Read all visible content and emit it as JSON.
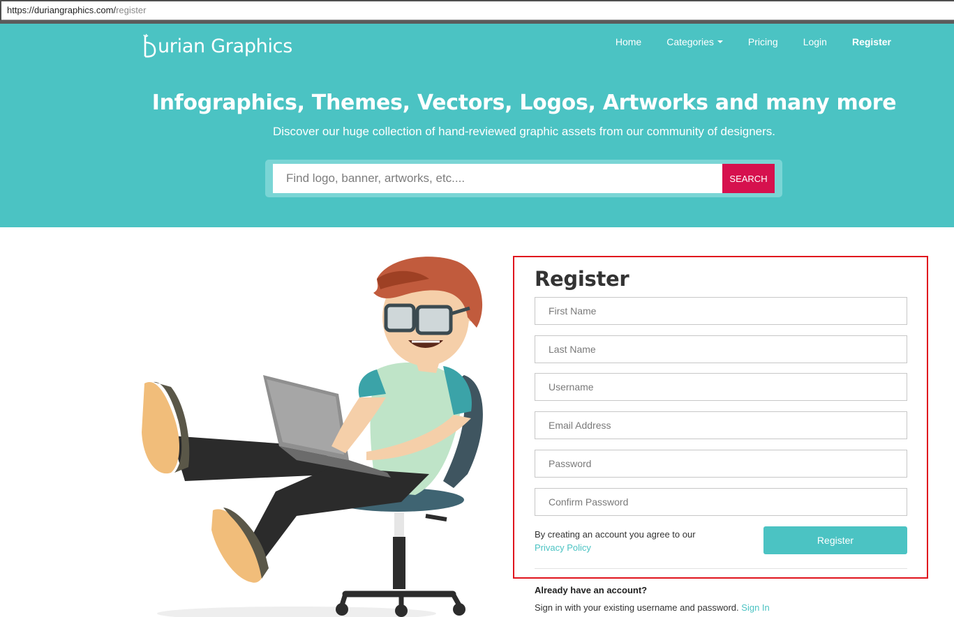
{
  "browser": {
    "url_main": "https://duriangraphics.com/",
    "url_path": "register"
  },
  "header": {
    "logo_text": "urian Graphics",
    "nav": [
      {
        "label": "Home"
      },
      {
        "label": "Categories"
      },
      {
        "label": "Pricing"
      },
      {
        "label": "Login"
      },
      {
        "label": "Register"
      }
    ]
  },
  "hero": {
    "headline": "Infographics, Themes, Vectors, Logos, Artworks and many more",
    "subline": "Discover our huge collection of hand-reviewed graphic assets from our community of designers.",
    "search_placeholder": "Find logo, banner, artworks, etc....",
    "search_button": "SEARCH"
  },
  "register": {
    "title": "Register",
    "fields": [
      {
        "placeholder": "First Name"
      },
      {
        "placeholder": "Last Name"
      },
      {
        "placeholder": "Username"
      },
      {
        "placeholder": "Email Address"
      },
      {
        "placeholder": "Password"
      },
      {
        "placeholder": "Confirm Password"
      }
    ],
    "agree_text": "By creating an account you agree to our",
    "privacy_link": "Privacy Policy",
    "submit_label": "Register",
    "already_text": "Already have an account?",
    "signin_text": "Sign in with your existing username and password.",
    "signin_link": "Sign In"
  },
  "colors": {
    "brand_teal": "#4bc3c3",
    "search_button": "#d6114e",
    "highlight_border": "#e0141d"
  }
}
